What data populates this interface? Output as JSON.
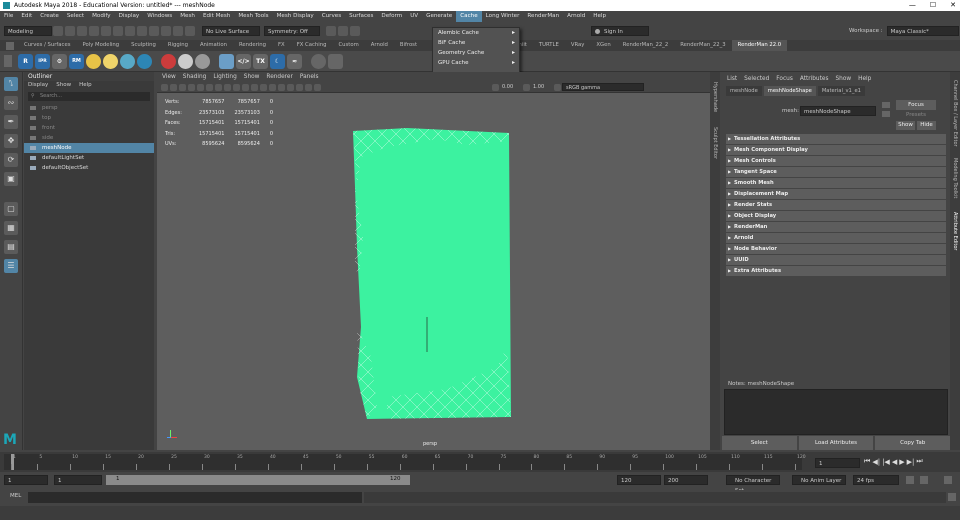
{
  "window": {
    "title": "Autodesk Maya 2018 - Educational Version: untitled*   ---   meshNode"
  },
  "menubar": {
    "items": [
      "File",
      "Edit",
      "Create",
      "Select",
      "Modify",
      "Display",
      "Windows",
      "Mesh",
      "Edit Mesh",
      "Mesh Tools",
      "Mesh Display",
      "Curves",
      "Surfaces",
      "Deform",
      "UV",
      "Generate",
      "Cache",
      "Long Winter",
      "RenderMan",
      "Arnold",
      "Help"
    ],
    "active_index": 16
  },
  "cache_menu": {
    "items": [
      "Alembic Cache",
      "BiF Cache",
      "Geometry Cache",
      "GPU Cache"
    ]
  },
  "statusline": {
    "mode": "Modeling",
    "live_surface": "No Live Surface",
    "symmetry": "Symmetry: Off",
    "sign_in": "Sign In",
    "workspace_label": "Workspace :",
    "workspace_value": "Maya Classic*"
  },
  "shelf_tabs": {
    "items": [
      "Curves / Surfaces",
      "Poly Modeling",
      "Sculpting",
      "Rigging",
      "Animation",
      "Rendering",
      "FX",
      "FX Caching",
      "Custom",
      "Arnold",
      "Bifrost",
      "Mash",
      "Motion Graphics",
      "XGen",
      "TURTLE",
      "VRay",
      "XGen",
      "RenderMan_22_2",
      "RenderMan_22_3",
      "RenderMan 22.0"
    ],
    "visible": [
      "Curves / Surfaces",
      "Poly Modeling",
      "Sculpting",
      "Rigging",
      "Animation",
      "Rendering",
      "FX",
      "FX Caching",
      "Custom",
      "Arnold",
      "Bifrost"
    ],
    "right_visible": [
      "iniit",
      "TURTLE",
      "VRay",
      "XGen",
      "RenderMan_22_2",
      "RenderMan_22_3",
      "RenderMan 22.0"
    ],
    "active": "RenderMan 22.0"
  },
  "outliner": {
    "title": "Outliner",
    "menu": [
      "Display",
      "Show",
      "Help"
    ],
    "search_placeholder": "Search...",
    "items": [
      {
        "label": "persp",
        "state": "dim"
      },
      {
        "label": "top",
        "state": "dim"
      },
      {
        "label": "front",
        "state": "dim"
      },
      {
        "label": "side",
        "state": "dim"
      },
      {
        "label": "meshNode",
        "state": "sel"
      },
      {
        "label": "defaultLightSet",
        "state": "normal"
      },
      {
        "label": "defaultObjectSet",
        "state": "normal"
      }
    ]
  },
  "viewport": {
    "menu": [
      "View",
      "Shading",
      "Lighting",
      "Show",
      "Renderer",
      "Panels"
    ],
    "exposure": "0.00",
    "gamma": "1.00",
    "colorspace": "sRGB gamma",
    "camera_label": "persp",
    "hud": {
      "rows": [
        {
          "label": "Verts:",
          "a": "7857657",
          "b": "7857657",
          "c": "0"
        },
        {
          "label": "Edges:",
          "a": "23573103",
          "b": "23573103",
          "c": "0"
        },
        {
          "label": "Faces:",
          "a": "15715401",
          "b": "15715401",
          "c": "0"
        },
        {
          "label": "Tris:",
          "a": "15715401",
          "b": "15715401",
          "c": "0"
        },
        {
          "label": "UVs:",
          "a": "8595624",
          "b": "8595624",
          "c": "0"
        }
      ]
    },
    "mesh_color": "#3cf2a0"
  },
  "side_tabs": [
    "Modeling Toolkit",
    "Channel Box / Layer Editor",
    "Attribute Editor",
    "Sculpt Editor",
    "Hypershade"
  ],
  "attribute_editor": {
    "menu": [
      "List",
      "Selected",
      "Focus",
      "Attributes",
      "Show",
      "Help"
    ],
    "tabs": [
      "meshNode",
      "meshNodeShape",
      "Material_v1_e1"
    ],
    "active_tab": "meshNodeShape",
    "mesh_label": "mesh:",
    "mesh_value": "meshNodeShape",
    "focus": "Focus",
    "presets": "Presets",
    "show": "Show",
    "hide": "Hide",
    "sections": [
      "Tessellation Attributes",
      "Mesh Component Display",
      "Mesh Controls",
      "Tangent Space",
      "Smooth Mesh",
      "Displacement Map",
      "Render Stats",
      "Object Display",
      "RenderMan",
      "Arnold",
      "Node Behavior",
      "UUID",
      "Extra Attributes"
    ],
    "notes_label": "Notes:",
    "notes_node": "meshNodeShape",
    "buttons": [
      "Select",
      "Load Attributes",
      "Copy Tab"
    ]
  },
  "timeline": {
    "ticks": [
      "1",
      "5",
      "10",
      "15",
      "20",
      "25",
      "30",
      "35",
      "40",
      "45",
      "50",
      "55",
      "60",
      "65",
      "70",
      "75",
      "80",
      "85",
      "90",
      "95",
      "100",
      "105",
      "110",
      "115",
      "120"
    ],
    "current": "1"
  },
  "range": {
    "start": "1",
    "anim_start": "1",
    "range_start": "1",
    "range_end": "120",
    "anim_end": "120",
    "end": "200",
    "character_set": "No Character Set",
    "anim_layer": "No Anim Layer",
    "fps": "24 fps"
  },
  "cmdline": {
    "label": "MEL"
  }
}
